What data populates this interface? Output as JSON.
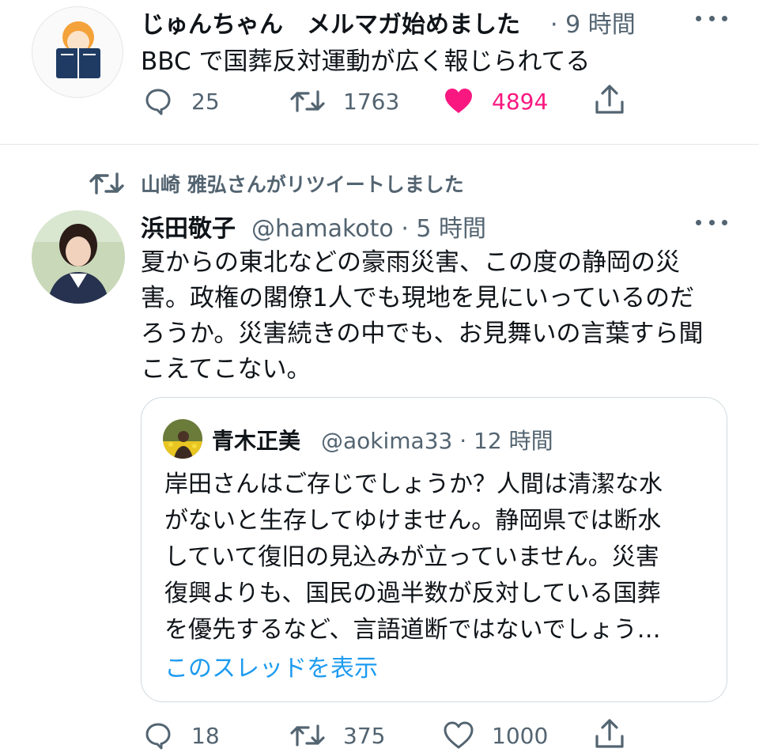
{
  "tweet1": {
    "name": "じゅんちゃん　メルマガ始めました",
    "time": "· 9 時間",
    "text": "BBC で国葬反対運動が広く報じられてる",
    "replies": "25",
    "retweets": "1763",
    "likes": "4894",
    "liked": true,
    "avatar_icon": "reading-person-avatar",
    "more_icon": "more-dots-icon"
  },
  "retweet_context": {
    "label": "山崎 雅弘さんがリツイートしました",
    "icon": "retweet-icon"
  },
  "tweet2": {
    "name": "浜田敬子",
    "handle": "@hamakoto · 5 時間",
    "lines": [
      "夏からの東北などの豪雨災害、この度の静岡の災",
      "害。政権の閣僚1人でも現地を見にいっているのだ",
      "ろうか。災害続きの中でも、お見舞いの言葉すら聞",
      "こえてこない。"
    ],
    "quote": {
      "name": "青木正美",
      "handle": "@aokima33 · 12 時間",
      "lines": [
        "岸田さんはご存じでしょうか？人間は清潔な水",
        "がないと生存してゆけません。静岡県では断水",
        "していて復旧の見込みが立っていません。災害",
        "復興よりも、国民の過半数が反対している国葬",
        "を優先するなど、言語道断ではないでしょう…"
      ],
      "thread_link": "このスレッドを表示"
    },
    "replies": "18",
    "retweets": "375",
    "likes": "1000",
    "liked": false
  },
  "colors": {
    "text": "#0f1419",
    "muted": "#536471",
    "like": "#f91880",
    "link": "#1d9bf0",
    "border": "#cfd9de"
  }
}
